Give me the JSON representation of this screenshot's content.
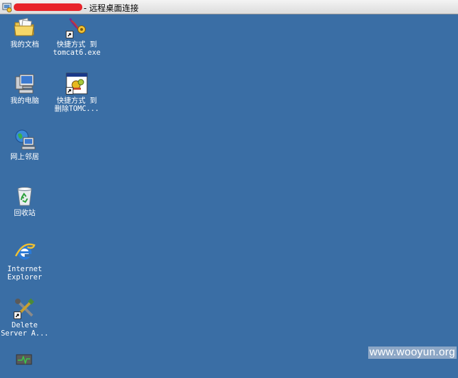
{
  "window": {
    "title": "- 远程桌面连接",
    "redacted_color": "#e8242a"
  },
  "desktop": {
    "background": "#3a6ea5",
    "icons": [
      {
        "name": "my-documents",
        "icon": "folder-documents-icon",
        "label": "我的文档"
      },
      {
        "name": "shortcut-tomcat6",
        "icon": "tomcat-feather-icon",
        "label_line1": "快捷方式 到",
        "label_line2": "tomcat6.exe"
      },
      {
        "name": "my-computer",
        "icon": "computer-icon",
        "label": "我的电脑"
      },
      {
        "name": "shortcut-delete-tomcat",
        "icon": "app-window-gear-icon",
        "label_line1": "快捷方式 到",
        "label_line2": "删除TOMC..."
      },
      {
        "name": "network-places",
        "icon": "network-globe-icon",
        "label": "网上邻居"
      },
      {
        "name": "recycle-bin",
        "icon": "recycle-bin-icon",
        "label": "回收站"
      },
      {
        "name": "internet-explorer",
        "icon": "ie-icon",
        "label_line1": "Internet",
        "label_line2": "Explorer"
      },
      {
        "name": "delete-server",
        "icon": "tools-icon",
        "label_line1": "Delete",
        "label_line2": "Server A..."
      }
    ]
  },
  "watermark": "www.wooyun.org"
}
